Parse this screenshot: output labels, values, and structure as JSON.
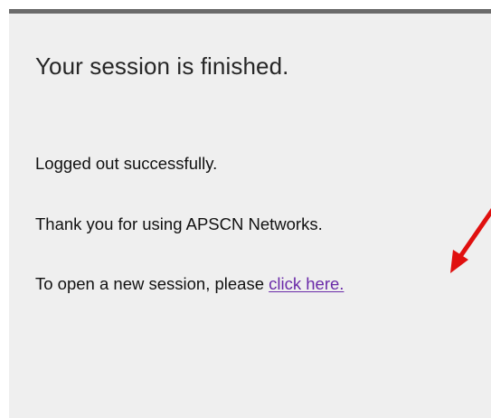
{
  "session": {
    "title": "Your session is finished.",
    "logged_out_message": "Logged out successfully.",
    "thanks_message": "Thank you for using APSCN Networks.",
    "open_prompt": "To open a new session, please ",
    "open_link": "click here."
  },
  "colors": {
    "panel_background": "#efefef",
    "top_bar": "#6b6b6b",
    "link": "#6a2aa8",
    "annotation_arrow": "#e0100f"
  },
  "annotation": {
    "icon": "red-arrow-icon"
  }
}
